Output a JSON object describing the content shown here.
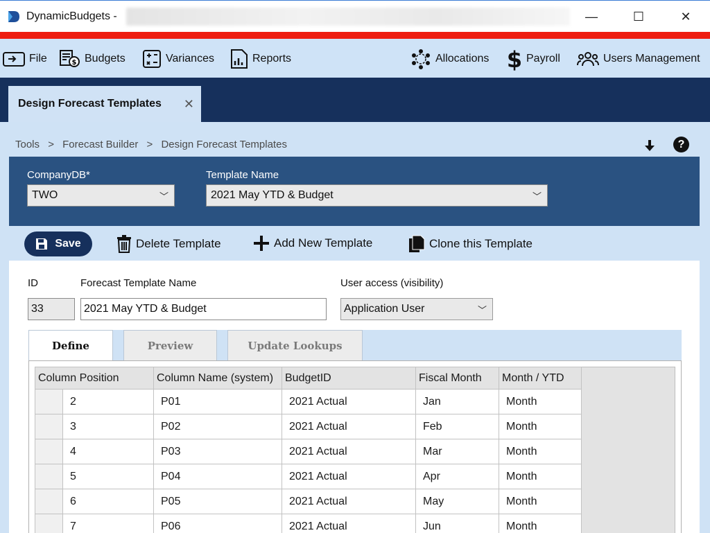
{
  "window": {
    "title": "DynamicBudgets -",
    "minimize": "—",
    "maximize": "☐",
    "close": "✕",
    "accent_color": "#ee1c10"
  },
  "menubar": {
    "items": [
      {
        "label": "File",
        "icon": "file-icon"
      },
      {
        "label": "Budgets",
        "icon": "budgets-icon"
      },
      {
        "label": "Variances",
        "icon": "variances-icon"
      },
      {
        "label": "Reports",
        "icon": "reports-icon"
      },
      {
        "label": "Allocations",
        "icon": "allocations-icon"
      },
      {
        "label": "Payroll",
        "icon": "dollar-icon"
      },
      {
        "label": "Users Management",
        "icon": "users-icon"
      }
    ]
  },
  "doc_tab": {
    "label": "Design Forecast Templates",
    "close": "✕"
  },
  "breadcrumb": [
    "Tools",
    "Forecast Builder",
    "Design Forecast Templates"
  ],
  "breadcrumb_sep": ">",
  "help": "?",
  "filters": {
    "company_label": "CompanyDB*",
    "company_value": "TWO",
    "template_label": "Template Name",
    "template_value": "2021 May YTD & Budget"
  },
  "actions": {
    "save": "Save",
    "delete": "Delete Template",
    "add": "Add New Template",
    "clone": "Clone this Template"
  },
  "form": {
    "id_label": "ID",
    "id_value": "33",
    "name_label": "Forecast Template Name",
    "name_value": "2021 May YTD & Budget",
    "access_label": "User access (visibility)",
    "access_value": "Application User"
  },
  "tabs": [
    "Define",
    "Preview",
    "Update Lookups"
  ],
  "grid": {
    "headers": [
      "Column Position",
      "Column Name (system)",
      "BudgetID",
      "Fiscal Month",
      "Month / YTD"
    ],
    "rows": [
      [
        "2",
        "P01",
        "2021 Actual",
        "Jan",
        "Month"
      ],
      [
        "3",
        "P02",
        "2021 Actual",
        "Feb",
        "Month"
      ],
      [
        "4",
        "P03",
        "2021 Actual",
        "Mar",
        "Month"
      ],
      [
        "5",
        "P04",
        "2021 Actual",
        "Apr",
        "Month"
      ],
      [
        "6",
        "P05",
        "2021 Actual",
        "May",
        "Month"
      ],
      [
        "7",
        "P06",
        "2021 Actual",
        "Jun",
        "Month"
      ]
    ]
  }
}
